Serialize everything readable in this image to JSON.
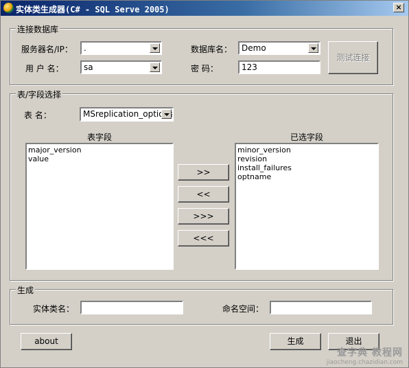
{
  "window": {
    "title": "实体类生成器(C# - SQL Serve 2005)",
    "close_label": "×"
  },
  "connection": {
    "group_title": "连接数据库",
    "server_label": "服务器名/IP：",
    "server_value": ".",
    "user_label": "用 户 名：",
    "user_value": "sa",
    "db_label": "数据库名：",
    "db_value": "Demo",
    "password_label": "密 码：",
    "password_value": "123",
    "test_button": "测试连接"
  },
  "fields": {
    "group_title": "表/字段选择",
    "table_label": "表 名：",
    "table_value": "MSreplication_options",
    "table_fields_header": "表字段",
    "selected_fields_header": "已选字段",
    "table_fields": [
      "major_version",
      "value"
    ],
    "selected_fields": [
      "minor_version",
      "revision",
      "install_failures",
      "optname"
    ],
    "btn_add": ">>",
    "btn_remove": "<<",
    "btn_add_all": ">>>",
    "btn_remove_all": "<<<"
  },
  "generate": {
    "group_title": "生成",
    "class_label": "实体类名：",
    "class_value": "",
    "namespace_label": "命名空间：",
    "namespace_value": ""
  },
  "footer": {
    "about_button": "about",
    "generate_button": "生成",
    "exit_button": "退出"
  },
  "watermark": {
    "line1": "查字典 教程网",
    "line2": "jiaocheng.chazidian.com"
  }
}
